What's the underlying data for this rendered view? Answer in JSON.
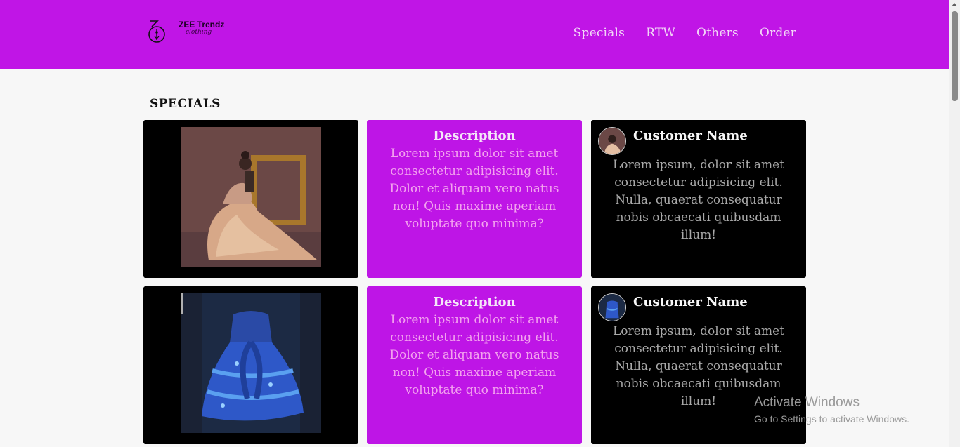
{
  "header": {
    "logo": {
      "name": "ZEE Trendz",
      "tagline": "clothing"
    },
    "nav": [
      "Specials",
      "RTW",
      "Others",
      "Order"
    ],
    "brand_color": "#c015e6"
  },
  "section": {
    "title": "SPECIALS"
  },
  "rows": [
    {
      "photo_icon": "photo-child-in-floral-gown",
      "description": {
        "title": "Description",
        "text": "Lorem ipsum dolor sit amet consectetur adipisicing elit. Dolor et aliquam vero natus non! Quis maxime aperiam voluptate quo minima?"
      },
      "review": {
        "name": "Customer Name",
        "text": "Lorem ipsum, dolor sit amet consectetur adipisicing elit. Nulla, quaerat consequatur nobis obcaecati quibusdam illum!"
      }
    },
    {
      "photo_icon": "photo-blue-dress-on-mannequin",
      "description": {
        "title": "Description",
        "text": "Lorem ipsum dolor sit amet consectetur adipisicing elit. Dolor et aliquam vero natus non! Quis maxime aperiam voluptate quo minima?"
      },
      "review": {
        "name": "Customer Name",
        "text": "Lorem ipsum, dolor sit amet consectetur adipisicing elit. Nulla, quaerat consequatur nobis obcaecati quibusdam illum!"
      }
    }
  ],
  "os_overlay": {
    "title": "Activate Windows",
    "subtitle": "Go to Settings to activate Windows."
  }
}
